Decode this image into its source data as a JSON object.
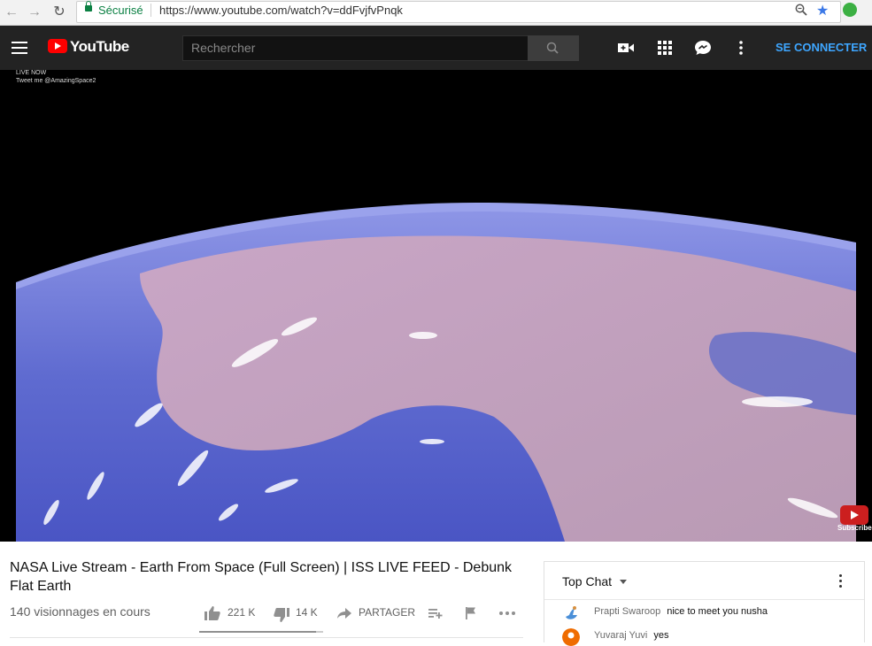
{
  "browser": {
    "secure_label": "Sécurisé",
    "url": "https://www.youtube.com/watch?v=ddFvjfvPnqk"
  },
  "masthead": {
    "logo_text": "YouTube",
    "search_placeholder": "Rechercher",
    "signin_label": "SE CONNECTER",
    "icons": [
      "menu-icon",
      "upload-video-icon",
      "apps-grid-icon",
      "messages-icon",
      "more-vert-icon"
    ]
  },
  "video": {
    "overlay_line1": "LIVE NOW",
    "overlay_line2": "Tweet me @AmazingSpace2",
    "subscribe_label": "Subscribe"
  },
  "info": {
    "title": "NASA Live Stream - Earth From Space (Full Screen) | ISS LIVE FEED - Debunk Flat Earth",
    "views": "140 visionnages en cours",
    "likes": "221 K",
    "dislikes": "14 K",
    "share_label": "PARTAGER",
    "like_ratio": 0.94
  },
  "chat": {
    "title": "Top Chat",
    "messages": [
      {
        "author": "Prapti Swaroop",
        "text": "nice to meet you nusha"
      },
      {
        "author": "Yuvaraj Yuvi",
        "text": "yes"
      }
    ]
  },
  "colors": {
    "masthead_bg": "#232323",
    "brand_red": "#ff0000",
    "signin_blue": "#3ea6ff",
    "secure_green": "#0b8043"
  }
}
